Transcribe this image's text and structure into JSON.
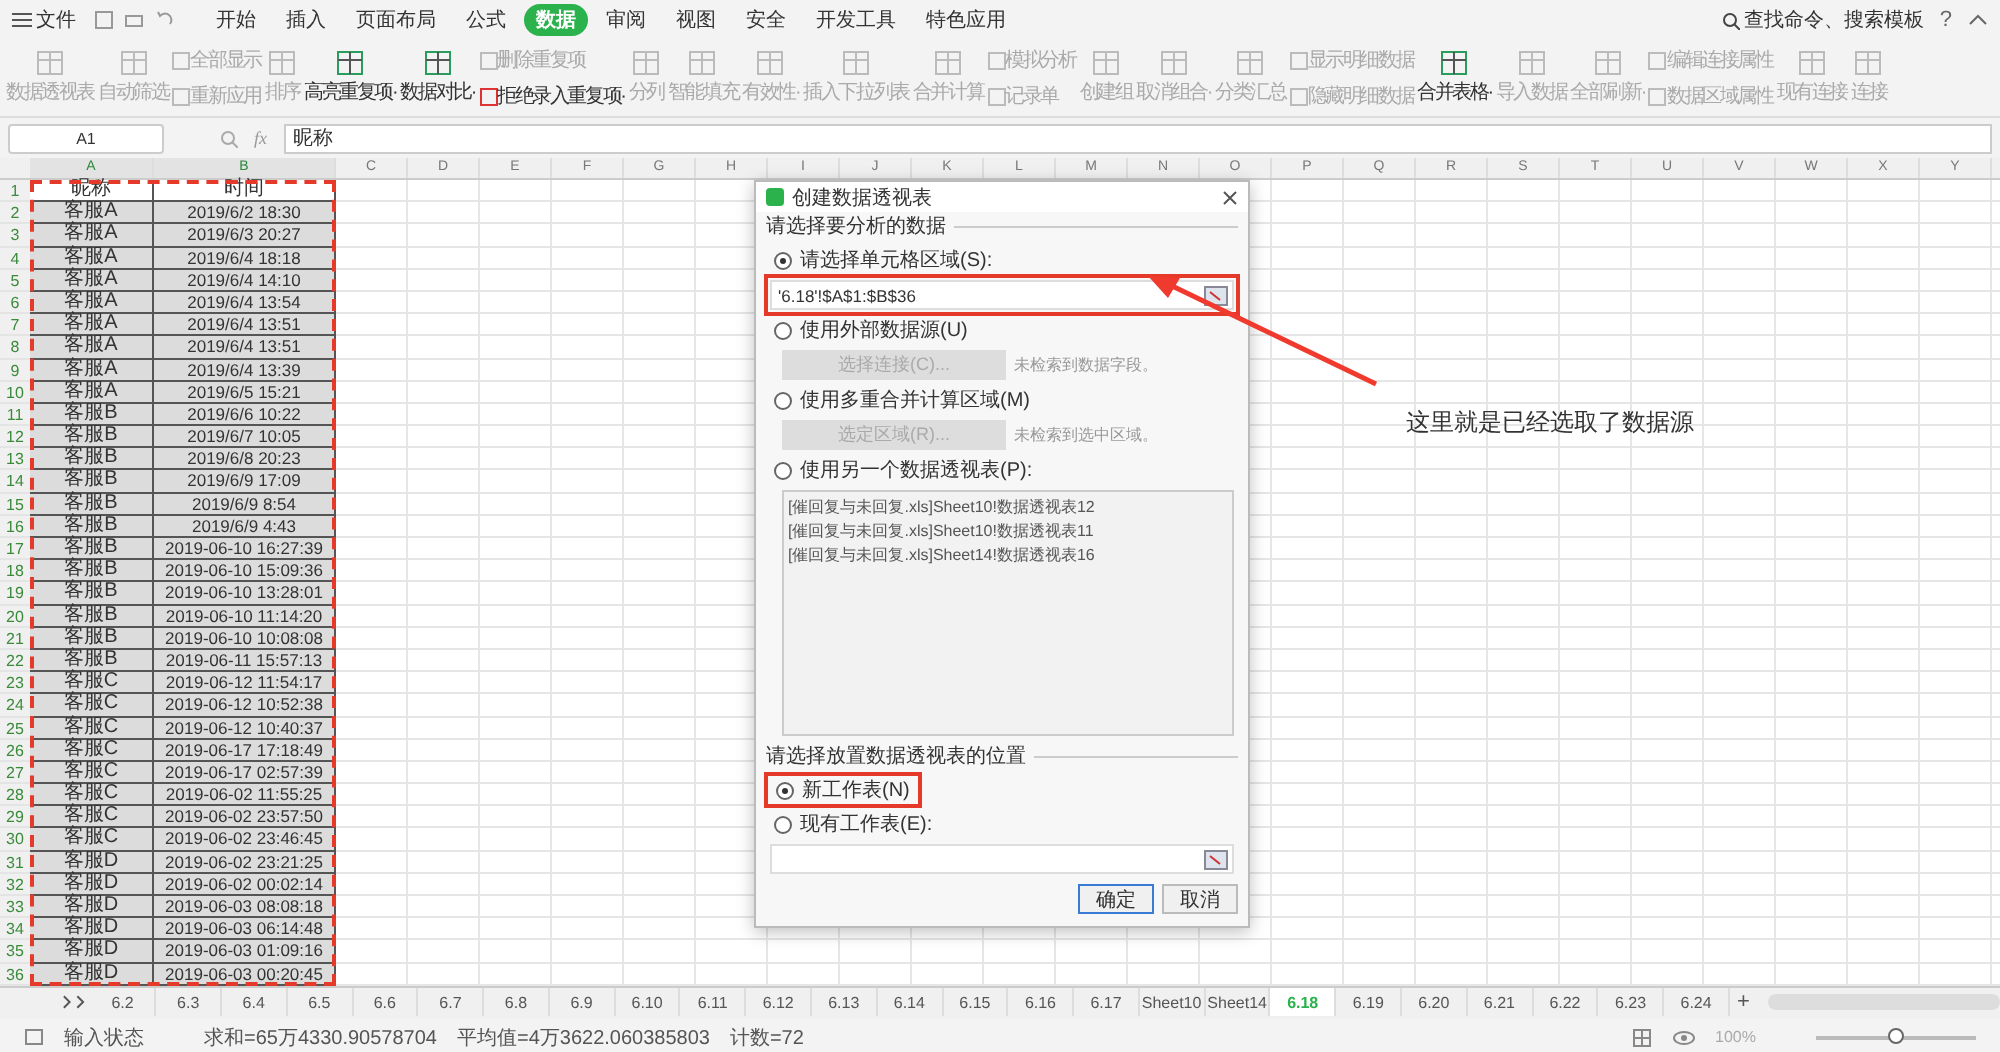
{
  "menu": {
    "file": "文件",
    "tabs": [
      {
        "label": "开始",
        "selected": false
      },
      {
        "label": "插入",
        "selected": false
      },
      {
        "label": "页面布局",
        "selected": false
      },
      {
        "label": "公式",
        "selected": false
      },
      {
        "label": "数据",
        "selected": true
      },
      {
        "label": "审阅",
        "selected": false
      },
      {
        "label": "视图",
        "selected": false
      },
      {
        "label": "安全",
        "selected": false
      },
      {
        "label": "开发工具",
        "selected": false
      },
      {
        "label": "特色应用",
        "selected": false
      }
    ],
    "search": "查找命令、搜索模板",
    "help": "?"
  },
  "ribbon": [
    {
      "kind": "large",
      "label": "数据透视表",
      "disabled": true
    },
    {
      "kind": "large",
      "label": "自动筛选",
      "disabled": true
    },
    {
      "kind": "stack",
      "items": [
        {
          "label": "全部显示",
          "disabled": true
        },
        {
          "label": "重新应用",
          "disabled": true
        }
      ]
    },
    {
      "kind": "large",
      "label": "排序",
      "disabled": true
    },
    {
      "kind": "large",
      "label": "高亮重复项·",
      "disabled": false
    },
    {
      "kind": "large",
      "label": "数据对比·",
      "disabled": false
    },
    {
      "kind": "stack",
      "items": [
        {
          "label": "删除重复项",
          "disabled": true
        },
        {
          "label": "拒绝录入重复项·",
          "disabled": false
        }
      ]
    },
    {
      "kind": "large",
      "label": "分列",
      "disabled": true
    },
    {
      "kind": "large",
      "label": "智能填充",
      "disabled": true
    },
    {
      "kind": "large",
      "label": "有效性·",
      "disabled": true
    },
    {
      "kind": "large",
      "label": "插入下拉列表",
      "disabled": true
    },
    {
      "kind": "large",
      "label": "合并计算",
      "disabled": true
    },
    {
      "kind": "stack",
      "items": [
        {
          "label": "模拟分析",
          "disabled": true
        },
        {
          "label": "记录单",
          "disabled": true
        }
      ]
    },
    {
      "kind": "large",
      "label": "创建组",
      "disabled": true
    },
    {
      "kind": "large",
      "label": "取消组合·",
      "disabled": true
    },
    {
      "kind": "large",
      "label": "分类汇总",
      "disabled": true
    },
    {
      "kind": "stack",
      "items": [
        {
          "label": "显示明细数据",
          "disabled": true
        },
        {
          "label": "隐藏明细数据",
          "disabled": true
        }
      ]
    },
    {
      "kind": "large",
      "label": "合并表格·",
      "disabled": false
    },
    {
      "kind": "large",
      "label": "导入数据",
      "disabled": true
    },
    {
      "kind": "large",
      "label": "全部刷新·",
      "disabled": true
    },
    {
      "kind": "stack",
      "items": [
        {
          "label": "编辑连接属性",
          "disabled": true
        },
        {
          "label": "数据区域属性",
          "disabled": true
        }
      ]
    },
    {
      "kind": "large",
      "label": "现有连接",
      "disabled": true
    },
    {
      "kind": "large",
      "label": "连接",
      "disabled": true
    }
  ],
  "formula_bar": {
    "cell_ref": "A1",
    "fx": "fx",
    "value": "昵称"
  },
  "sheet": {
    "columns": [
      "A",
      "B",
      "C",
      "D",
      "E",
      "F",
      "G",
      "H",
      "I",
      "J",
      "K",
      "L",
      "M",
      "N",
      "O",
      "P",
      "Q",
      "R",
      "S",
      "T",
      "U",
      "V",
      "W",
      "X",
      "Y"
    ],
    "rows": [
      {
        "number": "1",
        "kind": "header",
        "a": "昵称",
        "b": "时间"
      },
      {
        "number": "2",
        "kind": "data",
        "a": "客服A",
        "b": "2019/6/2 18:30"
      },
      {
        "number": "3",
        "kind": "data",
        "a": "客服A",
        "b": "2019/6/3 20:27"
      },
      {
        "number": "4",
        "kind": "data",
        "a": "客服A",
        "b": "2019/6/4 18:18"
      },
      {
        "number": "5",
        "kind": "data",
        "a": "客服A",
        "b": "2019/6/4 14:10"
      },
      {
        "number": "6",
        "kind": "data",
        "a": "客服A",
        "b": "2019/6/4 13:54"
      },
      {
        "number": "7",
        "kind": "data",
        "a": "客服A",
        "b": "2019/6/4 13:51"
      },
      {
        "number": "8",
        "kind": "data",
        "a": "客服A",
        "b": "2019/6/4 13:51"
      },
      {
        "number": "9",
        "kind": "data",
        "a": "客服A",
        "b": "2019/6/4 13:39"
      },
      {
        "number": "10",
        "kind": "data",
        "a": "客服A",
        "b": "2019/6/5 15:21"
      },
      {
        "number": "11",
        "kind": "data",
        "a": "客服B",
        "b": "2019/6/6 10:22"
      },
      {
        "number": "12",
        "kind": "data",
        "a": "客服B",
        "b": "2019/6/7 10:05"
      },
      {
        "number": "13",
        "kind": "data",
        "a": "客服B",
        "b": "2019/6/8 20:23"
      },
      {
        "number": "14",
        "kind": "data",
        "a": "客服B",
        "b": "2019/6/9 17:09"
      },
      {
        "number": "15",
        "kind": "data",
        "a": "客服B",
        "b": "2019/6/9 8:54"
      },
      {
        "number": "16",
        "kind": "data",
        "a": "客服B",
        "b": "2019/6/9 4:43"
      },
      {
        "number": "17",
        "kind": "data",
        "a": "客服B",
        "b": "2019-06-10 16:27:39"
      },
      {
        "number": "18",
        "kind": "data",
        "a": "客服B",
        "b": "2019-06-10 15:09:36"
      },
      {
        "number": "19",
        "kind": "data",
        "a": "客服B",
        "b": "2019-06-10 13:28:01"
      },
      {
        "number": "20",
        "kind": "data",
        "a": "客服B",
        "b": "2019-06-10 11:14:20"
      },
      {
        "number": "21",
        "kind": "data",
        "a": "客服B",
        "b": "2019-06-10 10:08:08"
      },
      {
        "number": "22",
        "kind": "data",
        "a": "客服B",
        "b": "2019-06-11 15:57:13"
      },
      {
        "number": "23",
        "kind": "data",
        "a": "客服C",
        "b": "2019-06-12 11:54:17"
      },
      {
        "number": "24",
        "kind": "data",
        "a": "客服C",
        "b": "2019-06-12 10:52:38"
      },
      {
        "number": "25",
        "kind": "data",
        "a": "客服C",
        "b": "2019-06-12 10:40:37"
      },
      {
        "number": "26",
        "kind": "data",
        "a": "客服C",
        "b": "2019-06-17 17:18:49"
      },
      {
        "number": "27",
        "kind": "data",
        "a": "客服C",
        "b": "2019-06-17 02:57:39"
      },
      {
        "number": "28",
        "kind": "data",
        "a": "客服C",
        "b": "2019-06-02 11:55:25"
      },
      {
        "number": "29",
        "kind": "data",
        "a": "客服C",
        "b": "2019-06-02 23:57:50"
      },
      {
        "number": "30",
        "kind": "data",
        "a": "客服C",
        "b": "2019-06-02 23:46:45"
      },
      {
        "number": "31",
        "kind": "data",
        "a": "客服D",
        "b": "2019-06-02 23:21:25"
      },
      {
        "number": "32",
        "kind": "data",
        "a": "客服D",
        "b": "2019-06-02 00:02:14"
      },
      {
        "number": "33",
        "kind": "data",
        "a": "客服D",
        "b": "2019-06-03 08:08:18"
      },
      {
        "number": "34",
        "kind": "data",
        "a": "客服D",
        "b": "2019-06-03 06:14:48"
      },
      {
        "number": "35",
        "kind": "data",
        "a": "客服D",
        "b": "2019-06-03 01:09:16"
      },
      {
        "number": "36",
        "kind": "data",
        "a": "客服D",
        "b": "2019-06-03 00:20:45"
      }
    ]
  },
  "sheet_tabs": {
    "tabs": [
      {
        "label": "6.2",
        "selected": false
      },
      {
        "label": "6.3",
        "selected": false
      },
      {
        "label": "6.4",
        "selected": false
      },
      {
        "label": "6.5",
        "selected": false
      },
      {
        "label": "6.6",
        "selected": false
      },
      {
        "label": "6.7",
        "selected": false
      },
      {
        "label": "6.8",
        "selected": false
      },
      {
        "label": "6.9",
        "selected": false
      },
      {
        "label": "6.10",
        "selected": false
      },
      {
        "label": "6.11",
        "selected": false
      },
      {
        "label": "6.12",
        "selected": false
      },
      {
        "label": "6.13",
        "selected": false
      },
      {
        "label": "6.14",
        "selected": false
      },
      {
        "label": "6.15",
        "selected": false
      },
      {
        "label": "6.16",
        "selected": false
      },
      {
        "label": "6.17",
        "selected": false
      },
      {
        "label": "Sheet10",
        "selected": false
      },
      {
        "label": "Sheet14",
        "selected": false
      },
      {
        "label": "6.18",
        "selected": true
      },
      {
        "label": "6.19",
        "selected": false
      },
      {
        "label": "6.20",
        "selected": false
      },
      {
        "label": "6.21",
        "selected": false
      },
      {
        "label": "6.22",
        "selected": false
      },
      {
        "label": "6.23",
        "selected": false
      },
      {
        "label": "6.24",
        "selected": false
      }
    ],
    "add": "+"
  },
  "status_bar": {
    "mode": "输入状态",
    "sum": "求和=65万4330.90578704",
    "average": "平均值=4万3622.060385803",
    "count": "计数=72",
    "zoom": "100%",
    "zoom_slider": {
      "level": 0.5
    }
  },
  "dialog": {
    "title": "创建数据透视表",
    "source_section": "请选择要分析的数据",
    "source_options": [
      {
        "kind": "range",
        "label": "请选择单元格区域(S):",
        "selected": true,
        "value": "'6.18'!$A$1:$B$36"
      },
      {
        "kind": "button",
        "label": "使用外部数据源(U)",
        "selected": false,
        "button": "选择连接(C)...",
        "note": "未检索到数据字段。"
      },
      {
        "kind": "button",
        "label": "使用多重合并计算区域(M)",
        "selected": false,
        "button": "选定区域(R)...",
        "note": "未检索到选中区域。"
      },
      {
        "kind": "list",
        "label": "使用另一个数据透视表(P):",
        "selected": false,
        "items": [
          "[催回复与未回复.xls]Sheet10!数据透视表12",
          "[催回复与未回复.xls]Sheet10!数据透视表11",
          "[催回复与未回复.xls]Sheet14!数据透视表16"
        ]
      }
    ],
    "place_section": "请选择放置数据透视表的位置",
    "place_options": [
      {
        "label": "新工作表(N)",
        "selected": true
      },
      {
        "label": "现有工作表(E):",
        "selected": false
      }
    ],
    "buttons": [
      {
        "label": "确定",
        "default": true
      },
      {
        "label": "取消",
        "default": false
      }
    ]
  },
  "annotation": "这里就是已经选取了数据源"
}
